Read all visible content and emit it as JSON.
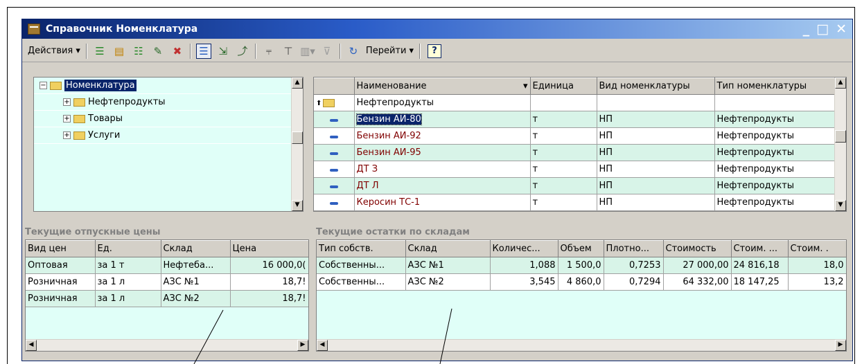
{
  "window": {
    "title": "Справочник Номенклатура",
    "controls": [
      "_",
      "□",
      "✕"
    ]
  },
  "toolbar": {
    "actions_label": "Действия ▾",
    "goto_label": "Перейти ▾",
    "help_label": "?"
  },
  "tree": {
    "root": "Номенклатура",
    "items": [
      "Нефтепродукты",
      "Товары",
      "Услуги"
    ]
  },
  "list": {
    "headers": [
      "Наименование",
      "Единица",
      "Вид номенклатуры",
      "Тип номенклатуры"
    ],
    "sort_indicator": "▾",
    "group_row": "Нефтепродукты",
    "rows": [
      {
        "name": "Бензин АИ-80",
        "unit": "т",
        "kind": "НП",
        "type": "Нефтепродукты"
      },
      {
        "name": "Бензин АИ-92",
        "unit": "т",
        "kind": "НП",
        "type": "Нефтепродукты"
      },
      {
        "name": "Бензин АИ-95",
        "unit": "т",
        "kind": "НП",
        "type": "Нефтепродукты"
      },
      {
        "name": "ДТ З",
        "unit": "т",
        "kind": "НП",
        "type": "Нефтепродукты"
      },
      {
        "name": "ДТ Л",
        "unit": "т",
        "kind": "НП",
        "type": "Нефтепродукты"
      },
      {
        "name": "Керосин ТС-1",
        "unit": "т",
        "kind": "НП",
        "type": "Нефтепродукты"
      }
    ]
  },
  "prices": {
    "title": "Текущие отпускные цены",
    "headers": [
      "Вид цен",
      "Ед.",
      "Склад",
      "Цена"
    ],
    "rows": [
      [
        "Оптовая",
        "за 1 т",
        "Нефтеба...",
        "16 000,0("
      ],
      [
        "Розничная",
        "за 1 л",
        "АЗС №1",
        "18,7!"
      ],
      [
        "Розничная",
        "за 1 л",
        "АЗС №2",
        "18,7!"
      ]
    ]
  },
  "stock": {
    "title": "Текущие остатки по складам",
    "headers": [
      "Тип собств.",
      "Склад",
      "Количес...",
      "Объем",
      "Плотно...",
      "Стоимость",
      "Стоим. ...",
      "Стоим. ."
    ],
    "rows": [
      [
        "Собственны...",
        "АЗС №1",
        "1,088",
        "1 500,0",
        "0,7253",
        "27 000,00",
        "24 816,18",
        "18,0"
      ],
      [
        "Собственны...",
        "АЗС №2",
        "3,545",
        "4 860,0",
        "0,7294",
        "64 332,00",
        "18 147,25",
        "13,2"
      ]
    ]
  }
}
